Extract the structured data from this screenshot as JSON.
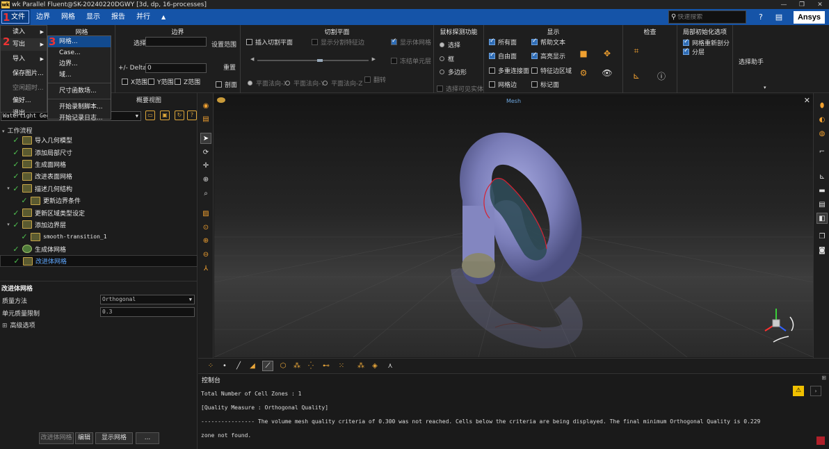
{
  "window": {
    "title": "wk Parallel Fluent@SK-20240220DGWY  [3d, dp, 16-processes]",
    "logo_text": "wk"
  },
  "menubar": {
    "items": [
      "文件",
      "边界",
      "网格",
      "显示",
      "报告",
      "并行",
      "▲"
    ],
    "search_placeholder": "快速搜索",
    "brand": "Ansys"
  },
  "file_menu": {
    "items": [
      "读入",
      "写出",
      "导入",
      "保存图片...",
      "空闲超时...",
      "偏好...",
      "退出"
    ]
  },
  "write_submenu": {
    "items": [
      "网格...",
      "Case...",
      "边界...",
      "域...",
      "尺寸函数场...",
      "开始录制脚本...",
      "开始记录日志..."
    ]
  },
  "annotations": [
    "1",
    "2",
    "3"
  ],
  "ribbon": {
    "mesh_section": {
      "title": "网格"
    },
    "boundary_section": {
      "title": "边界",
      "select_label": "选择",
      "set_range": "设置范围",
      "delta_label": "+/- Delta",
      "delta_value": "0",
      "reset": "重置",
      "section": "剖面",
      "x_range": "X范围",
      "y_range": "Y范围",
      "z_range": "Z范围"
    },
    "cut_plane_section": {
      "title": "切割平面",
      "insert": "插入切割平面",
      "show_edges": "显示分割特征边",
      "show_mesh": "显示体网格",
      "freeze": "冻结单元层",
      "flip": "翻转",
      "plane_x": "平面法向-X",
      "plane_y": "平面法向-Y",
      "plane_z": "平面法向-Z"
    },
    "probe_section": {
      "title": "鼠标探测功能",
      "opt1": "选择",
      "opt2": "框",
      "opt3": "多边形",
      "visible": "选择可见实体"
    },
    "display_section": {
      "title": "显示",
      "all_faces": "所有面",
      "help_text": "帮助文本",
      "free_faces": "自由面",
      "highlight": "高亮显示",
      "multi_faces": "多重连接面",
      "feature_regions": "特征边区域",
      "mesh_edges": "网格边",
      "mark_faces": "标记面"
    },
    "check_section": {
      "title": "检查"
    },
    "local_init_section": {
      "title": "局部初始化选项",
      "remesh": "网格重新剖分",
      "layered": "分层"
    },
    "select_helper": "选择助手"
  },
  "left_panel": {
    "tab_outline": "概要视图",
    "workflow_combo": "Watertight Geom",
    "workflow_head": "工作流程",
    "steps": [
      {
        "label": "导入几何模型",
        "level": 1
      },
      {
        "label": "添加局部尺寸",
        "level": 1
      },
      {
        "label": "生成面网格",
        "level": 1
      },
      {
        "label": "改进表面网格",
        "level": 1
      },
      {
        "label": "描述几何结构",
        "level": 1,
        "expand": true
      },
      {
        "label": "更新边界条件",
        "level": 2
      },
      {
        "label": "更新区域类型设定",
        "level": 1
      },
      {
        "label": "添加边界层",
        "level": 1,
        "expand": true
      },
      {
        "label": "smooth-transition_1",
        "level": 2
      },
      {
        "label": "生成体网格",
        "level": 1
      },
      {
        "label": "改进体网格",
        "level": 1,
        "selected": true
      }
    ],
    "task": {
      "title": "改进体网格",
      "quality_method_label": "质量方法",
      "quality_method_value": "Orthogonal",
      "cell_limit_label": "单元质量限制",
      "cell_limit_value": "0.3",
      "advanced": "高级选项"
    },
    "buttons": [
      "改进体网格",
      "编辑",
      "显示网格",
      "..."
    ]
  },
  "viewport": {
    "title": "Mesh"
  },
  "console": {
    "title": "控制台",
    "lines": [
      "Total Number of Cell Zones : 1",
      "[Quality Measure : Orthogonal Quality]",
      "---------------- The volume mesh quality criteria of 0.300 was not reached. Cells below the criteria are being displayed. The final minimum Orthogonal Quality is 0.229",
      "zone not found."
    ]
  },
  "colors": {
    "menubar": "#1554a8",
    "accent_orange": "#f0a030",
    "check_green": "#4fc14f",
    "pipe": "#8c8fc8"
  }
}
